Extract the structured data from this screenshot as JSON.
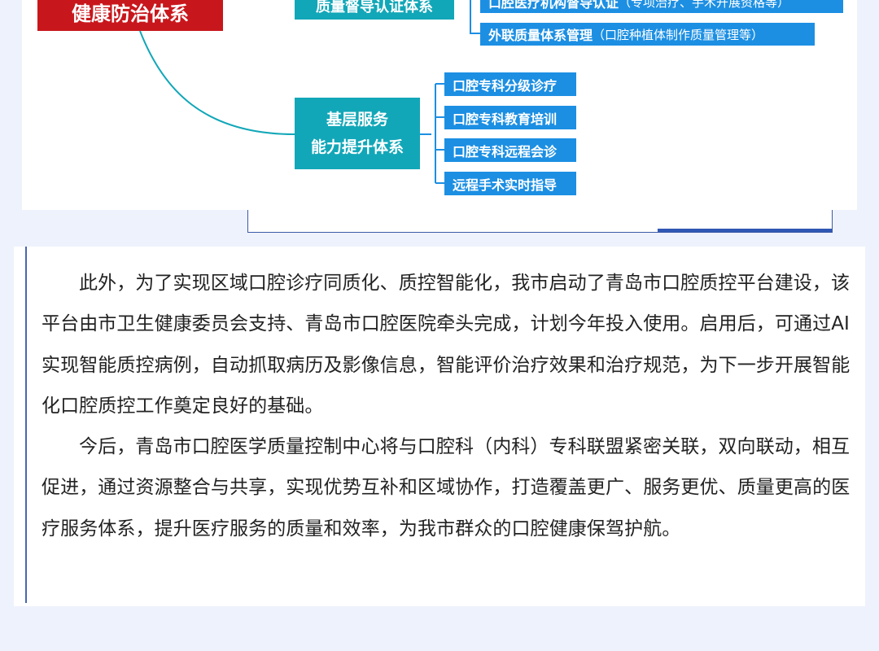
{
  "diagram": {
    "root_box": "健康防治体系",
    "top_box": "质量督导认证体系",
    "top_items": [
      {
        "main": "口腔医疗机构督导认证",
        "sub": "（专项治疗、手术开展资格等）"
      },
      {
        "main": "外联质量体系管理",
        "sub": "（口腔种植体制作质量管理等）"
      }
    ],
    "mid_box_line1": "基层服务",
    "mid_box_line2": "能力提升体系",
    "mid_items": [
      "口腔专科分级诊疗",
      "口腔专科教育培训",
      "口腔专科远程会诊",
      "远程手术实时指导"
    ],
    "colors": {
      "red": "#c8171c",
      "teal": "#12a7b8",
      "blue": "#1c8fe3"
    }
  },
  "article": {
    "paragraph1": "此外，为了实现区域口腔诊疗同质化、质控智能化，我市启动了青岛市口腔质控平台建设，该平台由市卫生健康委员会支持、青岛市口腔医院牵头完成，计划今年投入使用。启用后，可通过AI实现智能质控病例，自动抓取病历及影像信息，智能评价治疗效果和治疗规范，为下一步开展智能化口腔质控工作奠定良好的基础。",
    "paragraph2": "今后，青岛市口腔医学质量控制中心将与口腔科（内科）专科联盟紧密关联，双向联动，相互促进，通过资源整合与共享，实现优势互补和区域协作，打造覆盖更广、服务更优、质量更高的医疗服务体系，提升医疗服务的质量和效率，为我市群众的口腔健康保驾护航。"
  }
}
